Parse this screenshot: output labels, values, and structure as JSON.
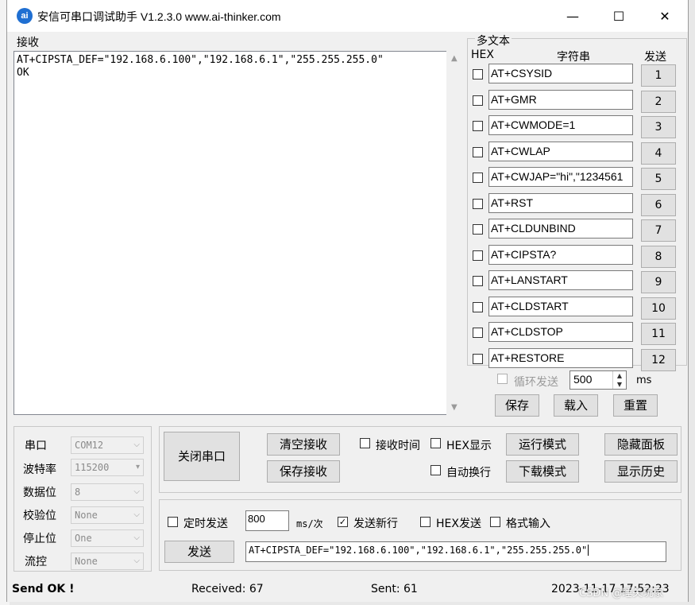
{
  "window": {
    "icon_text": "ai",
    "title": "安信可串口调试助手 V1.2.3.0    www.ai-thinker.com",
    "minimize": "—",
    "maximize": "☐",
    "close": "✕"
  },
  "receive": {
    "label": "接收",
    "lines": [
      "AT+CIPSTA_DEF=\"192.168.6.100\",\"192.168.6.1\",\"255.255.255.0\"",
      "",
      "OK"
    ]
  },
  "multi": {
    "label": "多文本",
    "hex_header": "HEX",
    "string_header": "字符串",
    "send_header": "发送",
    "rows": [
      {
        "text": "AT+CSYSID",
        "num": "1"
      },
      {
        "text": "AT+GMR",
        "num": "2"
      },
      {
        "text": "AT+CWMODE=1",
        "num": "3"
      },
      {
        "text": "AT+CWLAP",
        "num": "4"
      },
      {
        "text": "AT+CWJAP=\"hi\",\"1234561",
        "num": "5"
      },
      {
        "text": "AT+RST",
        "num": "6"
      },
      {
        "text": "AT+CLDUNBIND",
        "num": "7"
      },
      {
        "text": "AT+CIPSTA?",
        "num": "8"
      },
      {
        "text": "AT+LANSTART",
        "num": "9"
      },
      {
        "text": "AT+CLDSTART",
        "num": "10"
      },
      {
        "text": "AT+CLDSTOP",
        "num": "11"
      },
      {
        "text": "AT+RESTORE",
        "num": "12"
      }
    ],
    "loop_label": "循环发送",
    "loop_value": "500",
    "ms_label": "ms",
    "save": "保存",
    "load": "载入",
    "reset": "重置"
  },
  "serial": {
    "port_label": "串口",
    "port": "COM12",
    "baud_label": "波特率",
    "baud": "115200",
    "data_label": "数据位",
    "data": "8",
    "parity_label": "校验位",
    "parity": "None",
    "stop_label": "停止位",
    "stop": "One",
    "flow_label": "流控",
    "flow": "None"
  },
  "controls": {
    "close_port": "关闭串口",
    "clear_recv": "清空接收",
    "save_recv": "保存接收",
    "recv_time": "接收时间",
    "hex_display": "HEX显示",
    "auto_wrap": "自动换行",
    "run_mode": "运行模式",
    "download_mode": "下载模式",
    "hide_panel": "隐藏面板",
    "show_history": "显示历史"
  },
  "send": {
    "timed_send": "定时发送",
    "interval": "800",
    "interval_unit": "ms/次",
    "send_newline": "发送新行",
    "hex_send": "HEX发送",
    "format_input": "格式输入",
    "send_button": "发送",
    "input_value": "AT+CIPSTA_DEF=\"192.168.6.100\",\"192.168.6.1\",\"255.255.255.0\""
  },
  "status": {
    "send_ok": "Send OK !",
    "received": "Received: 67",
    "sent": "Sent: 61",
    "datetime": "2023-11-17 17:52:23",
    "watermark": "CSDN @睡关玩家"
  }
}
